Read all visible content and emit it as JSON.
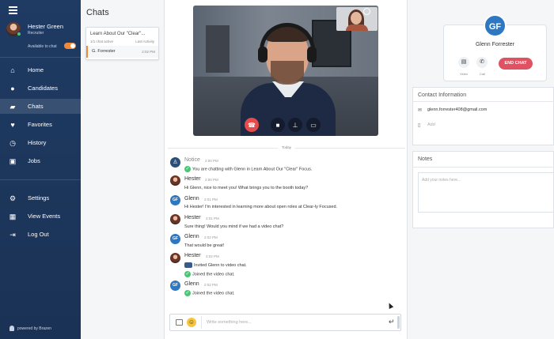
{
  "sidebar": {
    "user": {
      "name": "Hester Green",
      "role": "Recruiter",
      "availability_label": "Available to chat"
    },
    "nav": [
      {
        "label": "Home",
        "icon": "home-icon"
      },
      {
        "label": "Candidates",
        "icon": "user-icon"
      },
      {
        "label": "Chats",
        "icon": "chat-icon",
        "active": true
      },
      {
        "label": "Favorites",
        "icon": "heart-icon"
      },
      {
        "label": "History",
        "icon": "history-icon"
      },
      {
        "label": "Jobs",
        "icon": "briefcase-icon"
      }
    ],
    "nav_bottom": [
      {
        "label": "Settings",
        "icon": "gear-icon"
      },
      {
        "label": "View Events",
        "icon": "calendar-icon"
      },
      {
        "label": "Log Out",
        "icon": "logout-icon"
      }
    ],
    "powered_by": "powered by Brazen"
  },
  "chatlist": {
    "title": "Chats",
    "card": {
      "title": "Learn About Our \"Clear\"...",
      "active_count": "1/1 chat active",
      "last_activity_label": "Last Activity",
      "rows": [
        {
          "name": "G. Forrester",
          "time": "2:02 PM"
        }
      ]
    }
  },
  "messages": {
    "divider": "Today",
    "items": [
      {
        "sender": "Notice",
        "avatar": "notice",
        "time": "2:00 PM",
        "lines": [
          {
            "icon": "check",
            "text": "You are chatting with Glenn in Learn About Our \"Clear\" Focus."
          }
        ]
      },
      {
        "sender": "Hester",
        "avatar": "hester",
        "time": "2:00 PM",
        "lines": [
          {
            "text": "Hi Glenn, nice to meet you! What brings you to the booth today?"
          }
        ]
      },
      {
        "sender": "Glenn",
        "avatar": "GF",
        "time": "2:01 PM",
        "lines": [
          {
            "text": "Hi Hester! I'm interested in learning more about open roles at Clear-ly Focused."
          }
        ]
      },
      {
        "sender": "Hester",
        "avatar": "hester",
        "time": "2:01 PM",
        "lines": [
          {
            "text": "Sure thing! Would you mind if we had a video chat?"
          }
        ]
      },
      {
        "sender": "Glenn",
        "avatar": "GF",
        "time": "2:02 PM",
        "lines": [
          {
            "text": "That would be great!"
          }
        ]
      },
      {
        "sender": "Hester",
        "avatar": "hester",
        "time": "2:02 PM",
        "lines": [
          {
            "icon": "video",
            "text": "Invited Glenn to video chat."
          },
          {
            "icon": "check",
            "text": "Joined the video chat."
          }
        ]
      },
      {
        "sender": "Glenn",
        "avatar": "GF",
        "time": "2:02 PM",
        "lines": [
          {
            "icon": "check",
            "text": "Joined the video chat."
          }
        ]
      }
    ]
  },
  "composer": {
    "placeholder": "Write something here..."
  },
  "contact": {
    "initials": "GF",
    "name": "Glenn Forrester",
    "video_label": "Video",
    "call_label": "Call",
    "end_chat": "END CHAT",
    "info_title": "Contact Information",
    "email": "glenn.forrester408@gmail.com",
    "add_label": "Add",
    "notes_title": "Notes",
    "notes_placeholder": "Add your notes here..."
  },
  "colors": {
    "sidebar": "#1f3b63",
    "accent": "#f08a3a",
    "end_call": "#e54b4b",
    "end_chat": "#e05262",
    "avatar_blue": "#2e78c2",
    "online": "#48c774"
  }
}
